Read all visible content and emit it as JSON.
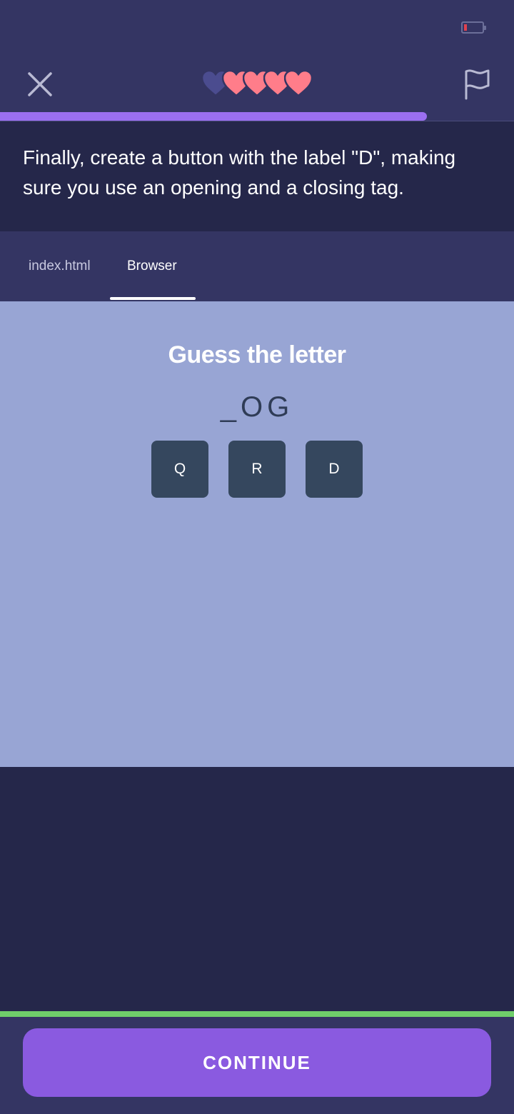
{
  "header": {
    "lives_total": 5,
    "lives_remaining": 4,
    "lesson_progress": 0.83
  },
  "icons": {
    "close": "close-icon",
    "flag": "flag-icon",
    "heart": "heart-icon",
    "battery": "battery-icon"
  },
  "instruction": {
    "text": "Finally, create a button with the label \"D\", making sure you use an opening and a closing tag."
  },
  "tabs": {
    "file_label": "index.html",
    "browser_label": "Browser",
    "active": "Browser"
  },
  "browser": {
    "title": "Guess the letter",
    "word": "_OG",
    "letters": [
      "Q",
      "R",
      "D"
    ]
  },
  "footer": {
    "continue_label": "CONTINUE"
  },
  "colors": {
    "heart_full": "#ff7d8a",
    "heart_empty": "#4b4c8f",
    "progress": "#9b6ff0",
    "continue": "#8a5ae0",
    "success_line": "#6fcf6a"
  }
}
